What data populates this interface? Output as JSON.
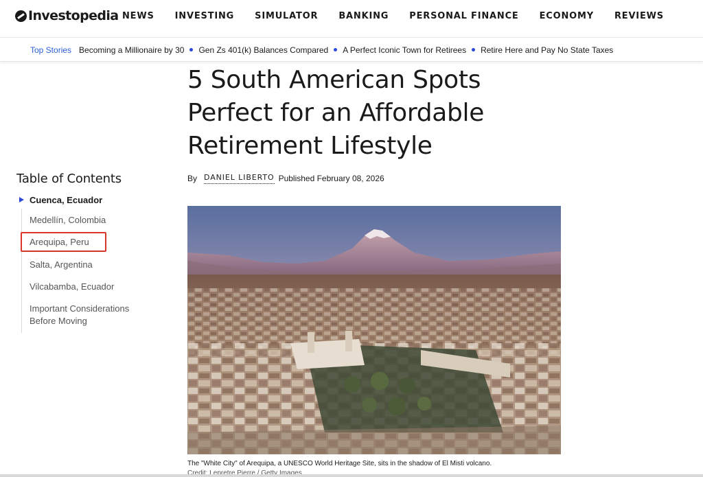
{
  "brand": {
    "logo_text": "Investopedia"
  },
  "nav": {
    "items": [
      {
        "label": "NEWS"
      },
      {
        "label": "INVESTING"
      },
      {
        "label": "SIMULATOR"
      },
      {
        "label": "BANKING"
      },
      {
        "label": "PERSONAL FINANCE"
      },
      {
        "label": "ECONOMY"
      },
      {
        "label": "REVIEWS"
      }
    ]
  },
  "top_stories": {
    "label": "Top Stories",
    "links": [
      {
        "label": "Becoming a Millionaire by 30"
      },
      {
        "label": "Gen Zs 401(k) Balances Compared"
      },
      {
        "label": "A Perfect Iconic Town for Retirees"
      },
      {
        "label": "Retire Here and Pay No State Taxes"
      }
    ]
  },
  "article": {
    "title": "5 South American Spots Perfect for an Affordable Retirement Lifestyle",
    "by_label": "By",
    "author": "DANIEL LIBERTO",
    "published": "Published February 08, 2026",
    "image_caption": "The \"White City\" of Arequipa, a UNESCO World Heritage Site, sits in the shadow of El Misti volcano.",
    "image_credit": "Credit: Lepretre Pierre / Getty Images"
  },
  "toc": {
    "title": "Table of Contents",
    "items": [
      {
        "label": "Cuenca, Ecuador",
        "active": true
      },
      {
        "label": "Medellín, Colombia"
      },
      {
        "label": "Arequipa, Peru",
        "highlighted": true
      },
      {
        "label": "Salta, Argentina"
      },
      {
        "label": "Vilcabamba, Ecuador"
      },
      {
        "label": "Important Considerations Before Moving"
      }
    ]
  },
  "colors": {
    "accent_blue": "#2c4ad6",
    "highlight_red": "#d9352b"
  }
}
